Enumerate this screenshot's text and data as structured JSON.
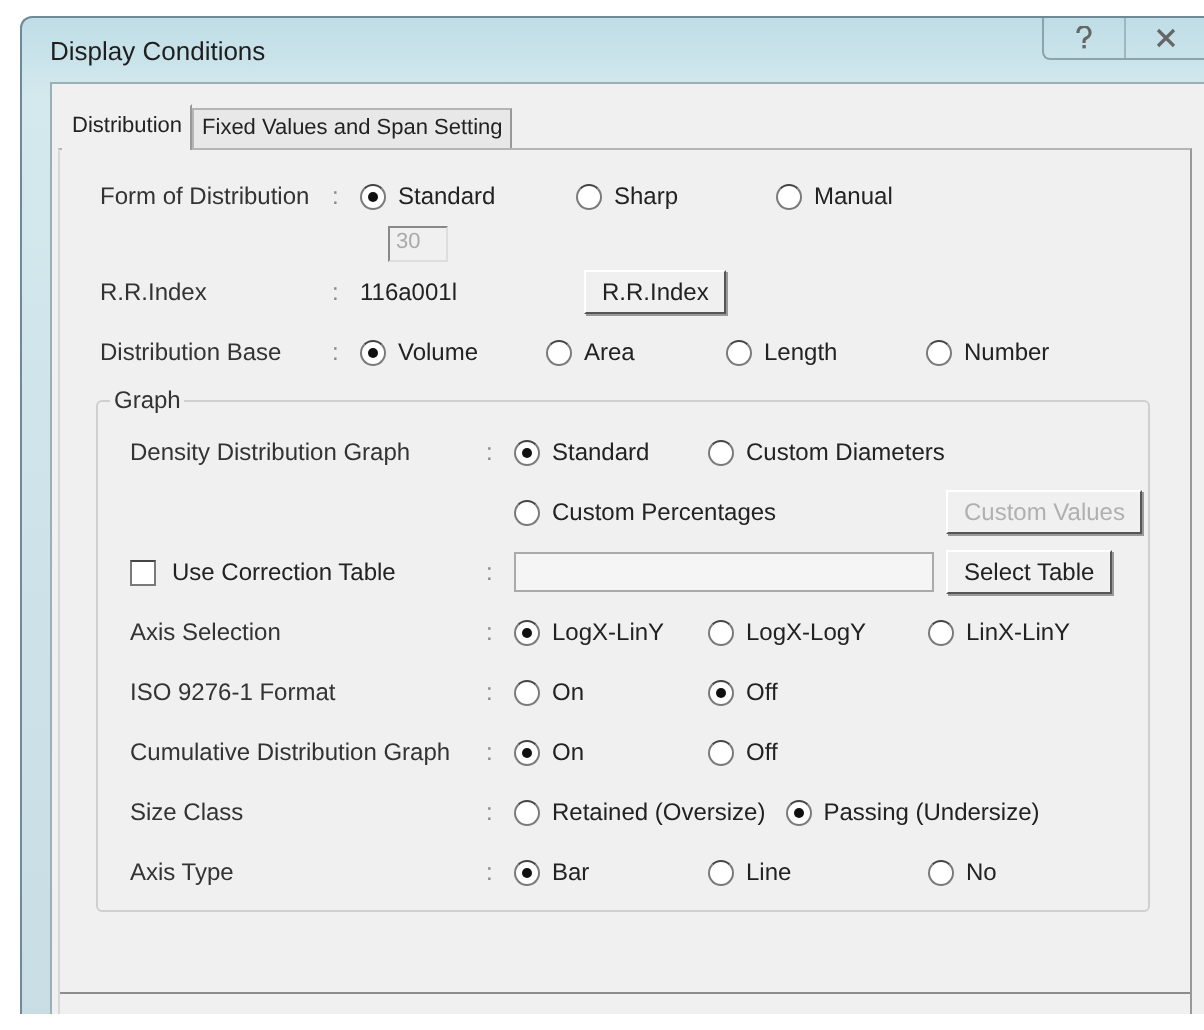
{
  "window": {
    "title": "Display Conditions"
  },
  "tabs": [
    {
      "label": "Distribution",
      "selected": true
    },
    {
      "label": "Fixed Values and Span Setting",
      "selected": false
    }
  ],
  "form_of_distribution": {
    "label": "Form of Distribution",
    "separator": ":",
    "options": [
      {
        "label": "Standard",
        "selected": true
      },
      {
        "label": "Sharp",
        "selected": false
      },
      {
        "label": "Manual",
        "selected": false
      }
    ]
  },
  "rr_index": {
    "spinner": {
      "value": "30",
      "disabled": true
    },
    "label": "R.R.Index",
    "separator": ":",
    "value": "116a001l",
    "button": "R.R.Index"
  },
  "distribution_base": {
    "label": "Distribution Base",
    "separator": ":",
    "options": [
      {
        "label": "Volume",
        "selected": true
      },
      {
        "label": "Area",
        "selected": false
      },
      {
        "label": "Length",
        "selected": false
      },
      {
        "label": "Number",
        "selected": false
      }
    ]
  },
  "graph": {
    "title": "Graph",
    "density": {
      "label": "Density Distribution Graph",
      "separator": ":",
      "options": [
        {
          "label": "Standard",
          "selected": true
        },
        {
          "label": "Custom Diameters",
          "selected": false
        },
        {
          "label": "Custom Percentages",
          "selected": false
        }
      ],
      "button": {
        "label": "Custom Values",
        "disabled": true
      }
    },
    "correction": {
      "label": "Use Correction Table",
      "checked": false,
      "separator": ":",
      "button": {
        "label": "Select Table",
        "disabled": false
      }
    },
    "rows": [
      {
        "label": "Axis Selection",
        "separator": ":",
        "options": [
          {
            "label": "LogX-LinY",
            "selected": true
          },
          {
            "label": "LogX-LogY",
            "selected": false
          },
          {
            "label": "LinX-LinY",
            "selected": false
          }
        ]
      },
      {
        "label": "ISO 9276-1 Format",
        "separator": ":",
        "options": [
          {
            "label": "On",
            "selected": false
          },
          {
            "label": "Off",
            "selected": true
          }
        ]
      },
      {
        "label": "Cumulative Distribution Graph",
        "separator": ":",
        "options": [
          {
            "label": "On",
            "selected": true
          },
          {
            "label": "Off",
            "selected": false
          }
        ]
      },
      {
        "label": "Size Class",
        "separator": ":",
        "options": [
          {
            "label": "Retained (Oversize)",
            "selected": false
          },
          {
            "label": "Passing (Undersize)",
            "selected": true
          }
        ]
      },
      {
        "label": "Axis Type",
        "separator": ":",
        "options": [
          {
            "label": "Bar",
            "selected": true
          },
          {
            "label": "Line",
            "selected": false
          },
          {
            "label": "No",
            "selected": false
          }
        ]
      }
    ]
  }
}
